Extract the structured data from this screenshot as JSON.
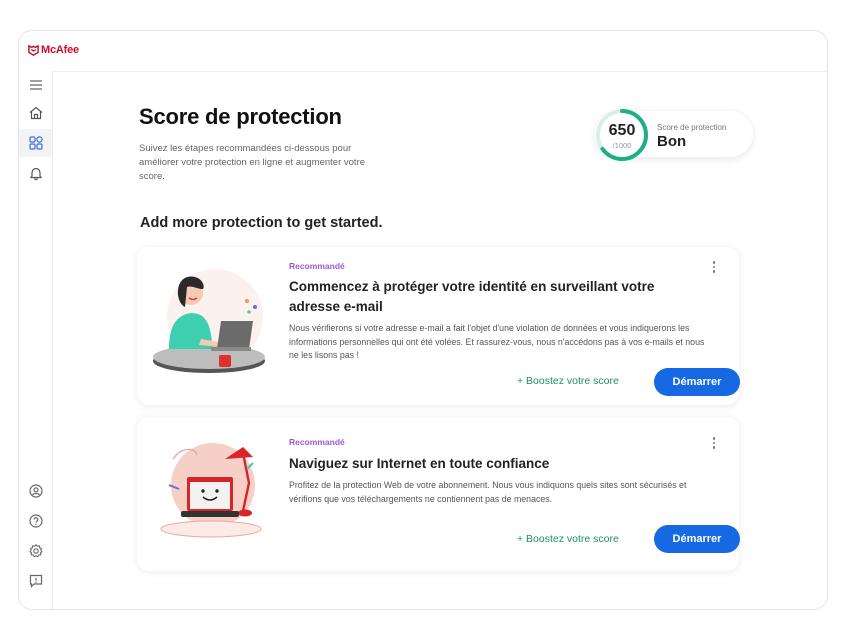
{
  "app": {
    "brand": "McAfee",
    "brand_color": "#c8102e",
    "accent_color": "#1668e3",
    "score_color": "#1fae87"
  },
  "sidebar": {
    "top_items": [
      {
        "name": "menu",
        "icon": "hamburger-icon"
      },
      {
        "name": "home",
        "icon": "home-icon"
      },
      {
        "name": "dashboard",
        "icon": "grid-icon",
        "active": true
      },
      {
        "name": "notifications",
        "icon": "bell-icon"
      }
    ],
    "bottom_items": [
      {
        "name": "account",
        "icon": "account-icon"
      },
      {
        "name": "help",
        "icon": "help-icon"
      },
      {
        "name": "settings",
        "icon": "gear-icon"
      },
      {
        "name": "feedback",
        "icon": "feedback-icon"
      }
    ]
  },
  "header": {
    "title": "Score de protection",
    "subtitle": "Suivez les étapes recommandées ci-dessous pour améliorer votre protection en ligne et augmenter votre score."
  },
  "score": {
    "value": "650",
    "max": "/1000",
    "fraction": 0.65,
    "label": "Score de protection",
    "rating": "Bon"
  },
  "section_title": "Add more protection to get started.",
  "cards": [
    {
      "tag": "Recommandé",
      "title": "Commencez à protéger votre identité en surveillant votre adresse e-mail",
      "description": "Nous vérifierons si votre adresse e-mail a fait l'objet d'une violation de données et vous indiquerons les informations personnelles qui ont été volées. Et rassurez-vous, nous n'accédons pas à vos e-mails et nous ne les lisons pas !",
      "boost_label": "+ Boostez votre score",
      "button_label": "Démarrer",
      "illustration": "woman-laptop-illustration"
    },
    {
      "tag": "Recommandé",
      "title": "Naviguez sur Internet en toute confiance",
      "description": "Profitez de la protection Web de votre abonnement. Nous vous indiquons quels sites sont sécurisés et vérifions que vos téléchargements ne contiennent pas de menaces.",
      "boost_label": "+ Boostez votre score",
      "button_label": "Démarrer",
      "illustration": "smiling-laptop-lamp-illustration"
    }
  ]
}
